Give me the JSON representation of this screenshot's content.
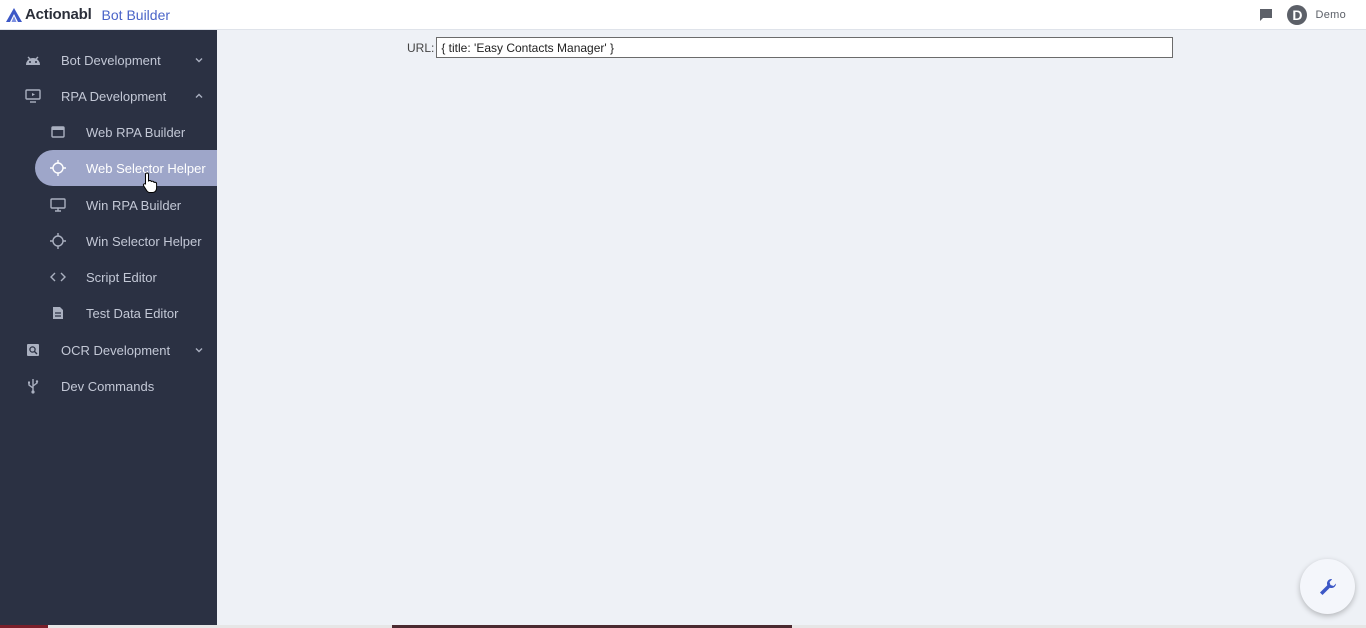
{
  "header": {
    "brand": "Actionabl",
    "subtitle": "Bot Builder",
    "user_initial": "D",
    "user_name": "Demo",
    "icons": {
      "chat": "chat-icon",
      "logo": "actionabl-logo"
    }
  },
  "sidebar": {
    "items": [
      {
        "label": "Bot Development",
        "icon": "android-icon",
        "expanded": false
      },
      {
        "label": "RPA Development",
        "icon": "monitor-play-icon",
        "expanded": true
      },
      {
        "label": "Web RPA Builder",
        "icon": "browser-window-icon"
      },
      {
        "label": "Web Selector Helper",
        "icon": "crosshair-icon",
        "active": true
      },
      {
        "label": "Win RPA Builder",
        "icon": "desktop-icon"
      },
      {
        "label": "Win Selector Helper",
        "icon": "crosshair-icon"
      },
      {
        "label": "Script Editor",
        "icon": "code-icon"
      },
      {
        "label": "Test Data Editor",
        "icon": "document-icon"
      },
      {
        "label": "OCR Development",
        "icon": "search-document-icon",
        "expanded": false
      },
      {
        "label": "Dev Commands",
        "icon": "usb-icon"
      }
    ]
  },
  "main": {
    "url_label": "URL:",
    "url_value": "{ title: 'Easy Contacts Manager' }"
  },
  "fab": {
    "icon": "wrench-icon"
  },
  "colors": {
    "sidebar_bg": "#2b3143",
    "active_item_bg": "#9ea6c9",
    "brand_accent": "#4a64c8",
    "main_bg": "#eef1f6"
  }
}
